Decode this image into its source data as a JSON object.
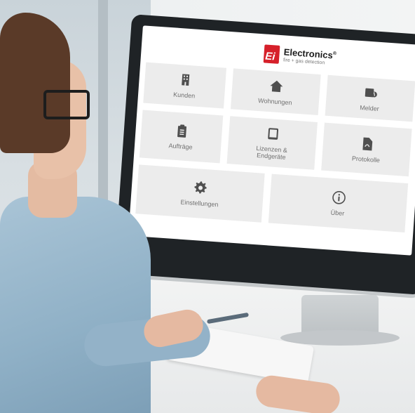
{
  "brand": {
    "name": "Electronics",
    "registered": "®",
    "tagline": "fire + gas detection",
    "logo_letters": "Ei",
    "logo_color": "#d6202a"
  },
  "tiles": [
    {
      "label": "Kunden",
      "icon": "building-icon"
    },
    {
      "label": "Wohnungen",
      "icon": "house-icon"
    },
    {
      "label": "Melder",
      "icon": "detector-flame-icon"
    },
    {
      "label": "Aufträge",
      "icon": "clipboard-icon"
    },
    {
      "label": "Lizenzen & Endgeräte",
      "icon": "tablet-icon"
    },
    {
      "label": "Protokolle",
      "icon": "pdf-document-icon"
    },
    {
      "label": "Einstellungen",
      "icon": "gear-icon"
    },
    {
      "label": "Über",
      "icon": "info-icon"
    }
  ],
  "colors": {
    "tile_bg": "#ececec",
    "icon": "#4f4f4f",
    "label": "#707070"
  }
}
